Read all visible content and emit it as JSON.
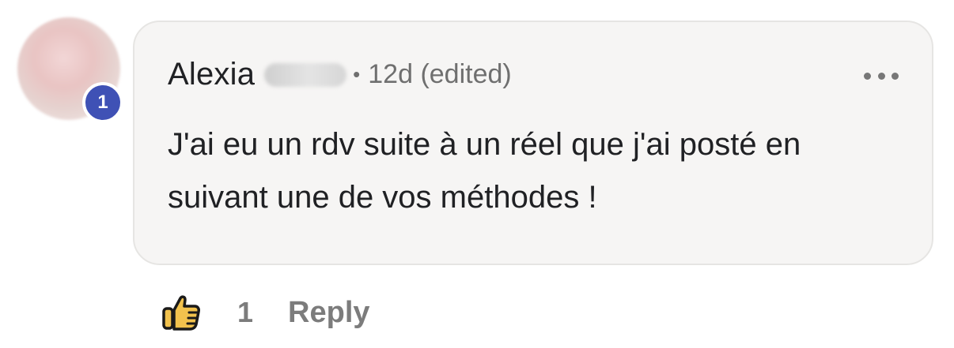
{
  "avatar": {
    "badge_count": "1",
    "badge_color": "#3f51b5"
  },
  "comment": {
    "author_first_name": "Alexia",
    "separator": "•",
    "timestamp": "12d (edited)",
    "text": "J'ai eu un rdv suite à un réel que j'ai posté en suivant une de vos méthodes !",
    "menu_icon": "more-horizontal-icon"
  },
  "actions": {
    "like_icon": "thumbs-up-icon",
    "like_count": "1",
    "reply_label": "Reply"
  },
  "colors": {
    "bubble_background": "#f6f5f4",
    "text": "#202124",
    "muted": "#6f6f6f",
    "like_fill": "#f2c24d"
  }
}
